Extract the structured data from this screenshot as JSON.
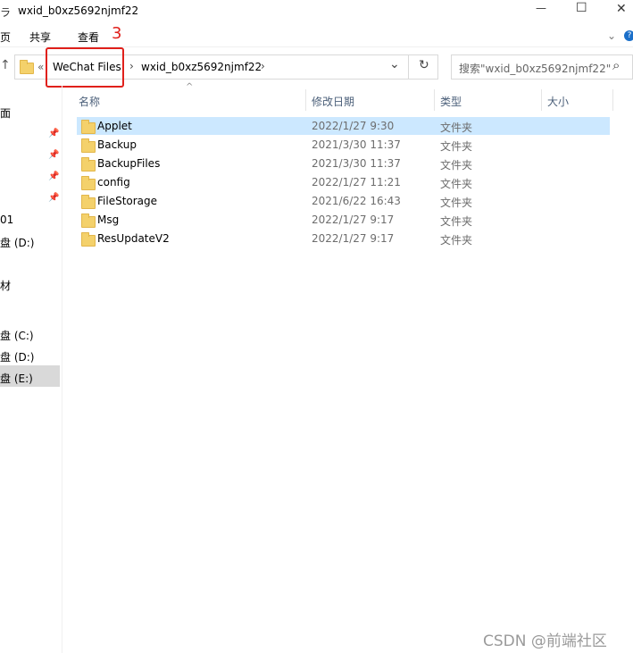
{
  "window": {
    "title_left_glyph": "ラ",
    "title": "wxid_b0xz5692njmf22",
    "minimize": "—",
    "maximize": "☐",
    "close": "✕"
  },
  "ribbon": {
    "tab_partial": "页",
    "tab_share": "共享",
    "tab_view": "查看",
    "annotation_number": "3",
    "annotation_color": "#e0201b"
  },
  "address": {
    "up_arrow": "↑",
    "overflow": "«",
    "crumb1": "WeChat Files",
    "sep1": "›",
    "crumb2": "wxid_b0xz5692njmf22",
    "sep2": "›",
    "dropdown": "⌄",
    "refresh": "↻",
    "search_placeholder": "搜索\"wxid_b0xz5692njmf22\"",
    "search_icon": "⌕"
  },
  "columns": {
    "name": "名称",
    "date": "修改日期",
    "type": "类型",
    "size": "大小"
  },
  "files": [
    {
      "name": "Applet",
      "date": "2022/1/27 9:30",
      "type": "文件夹"
    },
    {
      "name": "Backup",
      "date": "2021/3/30 11:37",
      "type": "文件夹"
    },
    {
      "name": "BackupFiles",
      "date": "2021/3/30 11:37",
      "type": "文件夹"
    },
    {
      "name": "config",
      "date": "2022/1/27 11:21",
      "type": "文件夹"
    },
    {
      "name": "FileStorage",
      "date": "2021/6/22 16:43",
      "type": "文件夹"
    },
    {
      "name": "Msg",
      "date": "2022/1/27 9:17",
      "type": "文件夹"
    },
    {
      "name": "ResUpdateV2",
      "date": "2022/1/27 9:17",
      "type": "文件夹"
    }
  ],
  "sidebar": {
    "item0": "面",
    "item1": "01",
    "item2": "盘 (D:)",
    "item3": "材",
    "item4": "盘 (C:)",
    "item5": "盘 (D:)",
    "item6": "盘 (E:)"
  },
  "watermark": "CSDN @前端社区"
}
